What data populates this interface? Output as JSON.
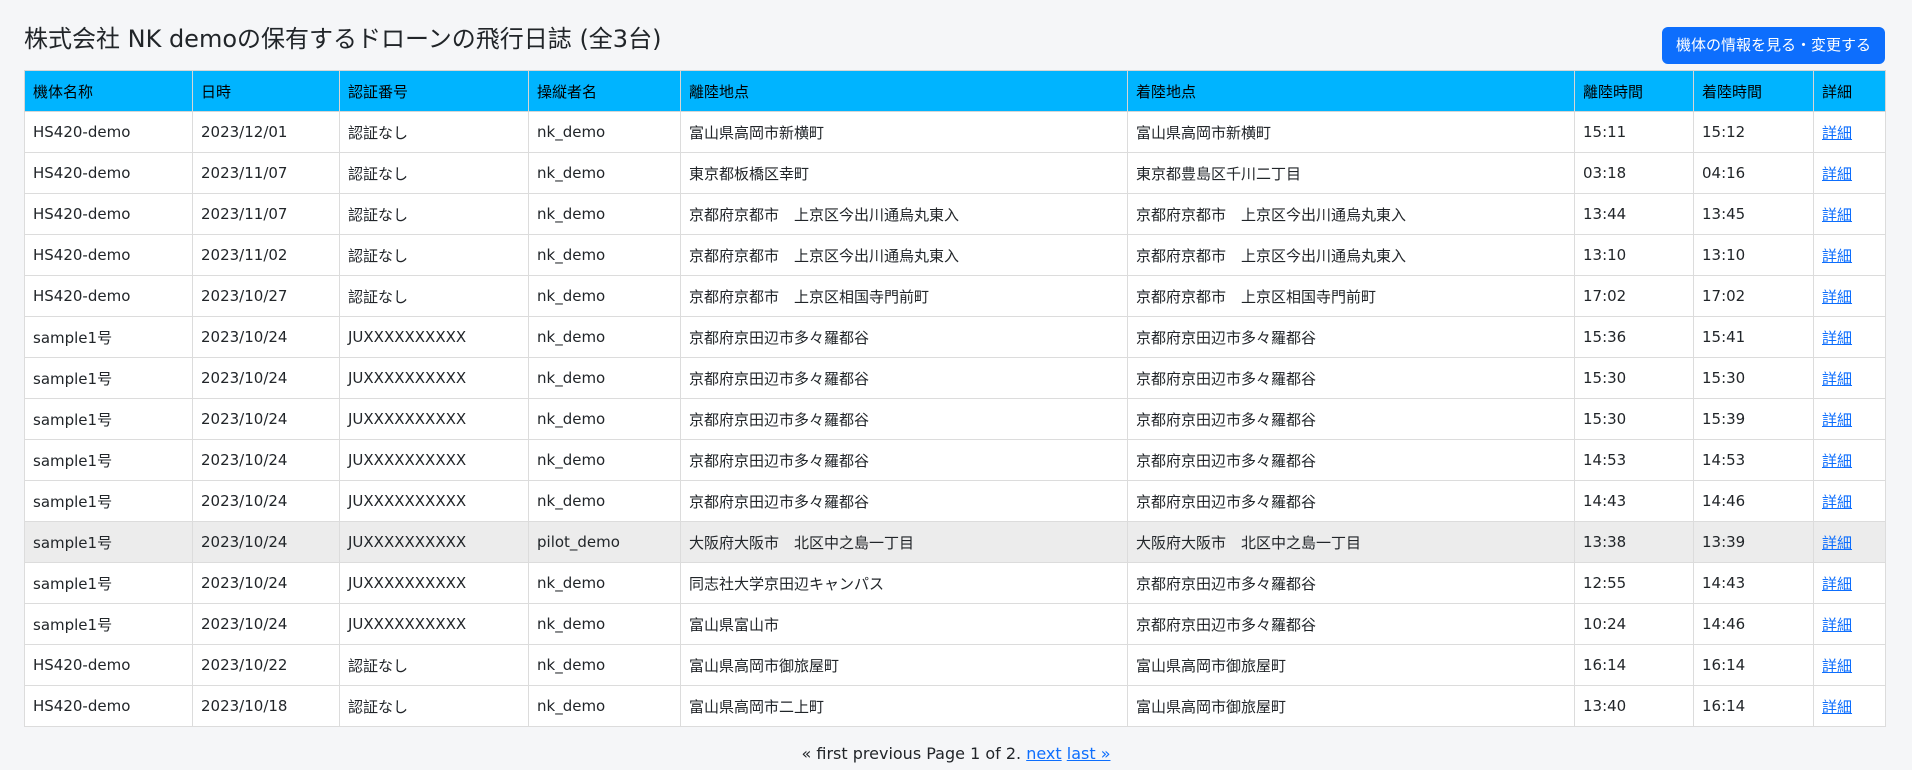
{
  "header": {
    "title": "株式会社 NK demoの保有するドローンの飛行日誌 (全3台)",
    "edit_button": "機体の情報を見る・変更する"
  },
  "table": {
    "columns": [
      "機体名称",
      "日時",
      "認証番号",
      "操縦者名",
      "離陸地点",
      "着陸地点",
      "離陸時間",
      "着陸時間",
      "詳細"
    ],
    "rows": [
      {
        "aircraft": "HS420-demo",
        "date": "2023/12/01",
        "cert": "認証なし",
        "pilot": "nk_demo",
        "takeoff_place": "富山県高岡市新横町",
        "landing_place": "富山県高岡市新横町",
        "takeoff_time": "15:11",
        "landing_time": "15:12",
        "detail": "詳細"
      },
      {
        "aircraft": "HS420-demo",
        "date": "2023/11/07",
        "cert": "認証なし",
        "pilot": "nk_demo",
        "takeoff_place": "東京都板橋区幸町",
        "landing_place": "東京都豊島区千川二丁目",
        "takeoff_time": "03:18",
        "landing_time": "04:16",
        "detail": "詳細"
      },
      {
        "aircraft": "HS420-demo",
        "date": "2023/11/07",
        "cert": "認証なし",
        "pilot": "nk_demo",
        "takeoff_place": "京都府京都市　上京区今出川通烏丸東入",
        "landing_place": "京都府京都市　上京区今出川通烏丸東入",
        "takeoff_time": "13:44",
        "landing_time": "13:45",
        "detail": "詳細"
      },
      {
        "aircraft": "HS420-demo",
        "date": "2023/11/02",
        "cert": "認証なし",
        "pilot": "nk_demo",
        "takeoff_place": "京都府京都市　上京区今出川通烏丸東入",
        "landing_place": "京都府京都市　上京区今出川通烏丸東入",
        "takeoff_time": "13:10",
        "landing_time": "13:10",
        "detail": "詳細"
      },
      {
        "aircraft": "HS420-demo",
        "date": "2023/10/27",
        "cert": "認証なし",
        "pilot": "nk_demo",
        "takeoff_place": "京都府京都市　上京区相国寺門前町",
        "landing_place": "京都府京都市　上京区相国寺門前町",
        "takeoff_time": "17:02",
        "landing_time": "17:02",
        "detail": "詳細"
      },
      {
        "aircraft": "sample1号",
        "date": "2023/10/24",
        "cert": "JUXXXXXXXXXX",
        "pilot": "nk_demo",
        "takeoff_place": "京都府京田辺市多々羅都谷",
        "landing_place": "京都府京田辺市多々羅都谷",
        "takeoff_time": "15:36",
        "landing_time": "15:41",
        "detail": "詳細"
      },
      {
        "aircraft": "sample1号",
        "date": "2023/10/24",
        "cert": "JUXXXXXXXXXX",
        "pilot": "nk_demo",
        "takeoff_place": "京都府京田辺市多々羅都谷",
        "landing_place": "京都府京田辺市多々羅都谷",
        "takeoff_time": "15:30",
        "landing_time": "15:30",
        "detail": "詳細"
      },
      {
        "aircraft": "sample1号",
        "date": "2023/10/24",
        "cert": "JUXXXXXXXXXX",
        "pilot": "nk_demo",
        "takeoff_place": "京都府京田辺市多々羅都谷",
        "landing_place": "京都府京田辺市多々羅都谷",
        "takeoff_time": "15:30",
        "landing_time": "15:39",
        "detail": "詳細"
      },
      {
        "aircraft": "sample1号",
        "date": "2023/10/24",
        "cert": "JUXXXXXXXXXX",
        "pilot": "nk_demo",
        "takeoff_place": "京都府京田辺市多々羅都谷",
        "landing_place": "京都府京田辺市多々羅都谷",
        "takeoff_time": "14:53",
        "landing_time": "14:53",
        "detail": "詳細"
      },
      {
        "aircraft": "sample1号",
        "date": "2023/10/24",
        "cert": "JUXXXXXXXXXX",
        "pilot": "nk_demo",
        "takeoff_place": "京都府京田辺市多々羅都谷",
        "landing_place": "京都府京田辺市多々羅都谷",
        "takeoff_time": "14:43",
        "landing_time": "14:46",
        "detail": "詳細"
      },
      {
        "aircraft": "sample1号",
        "date": "2023/10/24",
        "cert": "JUXXXXXXXXXX",
        "pilot": "pilot_demo",
        "takeoff_place": "大阪府大阪市　北区中之島一丁目",
        "landing_place": "大阪府大阪市　北区中之島一丁目",
        "takeoff_time": "13:38",
        "landing_time": "13:39",
        "detail": "詳細",
        "highlighted": true
      },
      {
        "aircraft": "sample1号",
        "date": "2023/10/24",
        "cert": "JUXXXXXXXXXX",
        "pilot": "nk_demo",
        "takeoff_place": "同志社大学京田辺キャンパス",
        "landing_place": "京都府京田辺市多々羅都谷",
        "takeoff_time": "12:55",
        "landing_time": "14:43",
        "detail": "詳細"
      },
      {
        "aircraft": "sample1号",
        "date": "2023/10/24",
        "cert": "JUXXXXXXXXXX",
        "pilot": "nk_demo",
        "takeoff_place": "富山県富山市",
        "landing_place": "京都府京田辺市多々羅都谷",
        "takeoff_time": "10:24",
        "landing_time": "14:46",
        "detail": "詳細"
      },
      {
        "aircraft": "HS420-demo",
        "date": "2023/10/22",
        "cert": "認証なし",
        "pilot": "nk_demo",
        "takeoff_place": "富山県高岡市御旅屋町",
        "landing_place": "富山県高岡市御旅屋町",
        "takeoff_time": "16:14",
        "landing_time": "16:14",
        "detail": "詳細"
      },
      {
        "aircraft": "HS420-demo",
        "date": "2023/10/18",
        "cert": "認証なし",
        "pilot": "nk_demo",
        "takeoff_place": "富山県高岡市二上町",
        "landing_place": "富山県高岡市御旅屋町",
        "takeoff_time": "13:40",
        "landing_time": "16:14",
        "detail": "詳細"
      }
    ]
  },
  "pagination": {
    "first": "« first",
    "previous": "previous",
    "status": "Page 1 of 2.",
    "next": "next",
    "last": "last »"
  },
  "colors": {
    "header_bg": "#00b4ff",
    "button_bg": "#0d6efd",
    "link": "#0d6efd",
    "highlight_row": "#ececec"
  }
}
